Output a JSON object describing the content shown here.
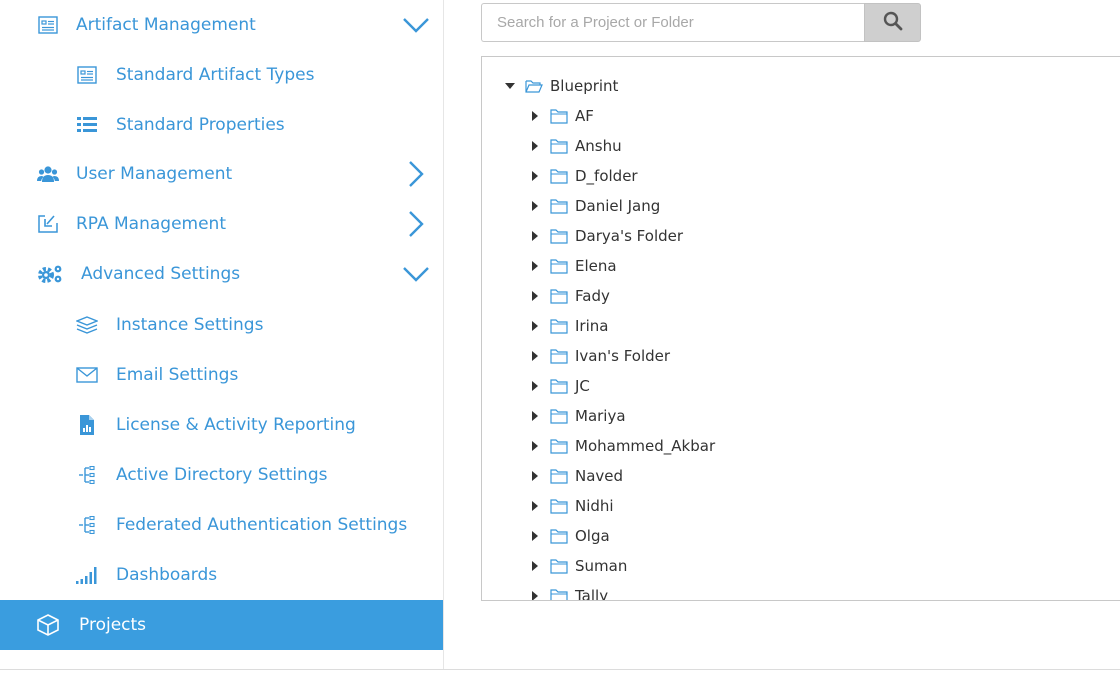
{
  "sidebar": {
    "artifact_management": {
      "label": "Artifact Management",
      "icon": "artifact-icon",
      "expanded": true
    },
    "standard_artifact_types": {
      "label": "Standard Artifact Types",
      "icon": "artifact-types-icon"
    },
    "standard_properties": {
      "label": "Standard Properties",
      "icon": "properties-list-icon"
    },
    "user_management": {
      "label": "User Management",
      "icon": "users-icon",
      "expanded": false
    },
    "rpa_management": {
      "label": "RPA Management",
      "icon": "rpa-import-icon",
      "expanded": false
    },
    "advanced_settings": {
      "label": "Advanced Settings",
      "icon": "gears-icon",
      "expanded": true
    },
    "instance_settings": {
      "label": "Instance Settings",
      "icon": "layers-icon"
    },
    "email_settings": {
      "label": "Email Settings",
      "icon": "envelope-icon"
    },
    "license_reporting": {
      "label": "License & Activity Reporting",
      "icon": "report-file-icon"
    },
    "active_directory": {
      "label": "Active Directory Settings",
      "icon": "directory-tree-icon"
    },
    "federated_auth": {
      "label": "Federated Authentication Settings",
      "icon": "directory-tree-icon"
    },
    "dashboards": {
      "label": "Dashboards",
      "icon": "signal-bars-icon"
    },
    "projects": {
      "label": "Projects",
      "icon": "cube-icon",
      "active": true
    }
  },
  "search": {
    "placeholder": "Search for a Project or Folder",
    "value": "",
    "button_icon": "search-icon"
  },
  "tree": {
    "root": {
      "label": "Blueprint",
      "expanded": true
    },
    "children": [
      "AF",
      "Anshu",
      "D_folder",
      "Daniel Jang",
      "Darya's Folder",
      "Elena",
      "Fady",
      "Irina",
      "Ivan's Folder",
      "JC",
      "Mariya",
      "Mohammed_Akbar",
      "Naved",
      "Nidhi",
      "Olga",
      "Suman",
      "Tally"
    ]
  },
  "colors": {
    "accent": "#3a96d8",
    "active_bg": "#3a9ddf",
    "active_text": "#ffffff",
    "search_button_bg": "#cfcfcf"
  }
}
